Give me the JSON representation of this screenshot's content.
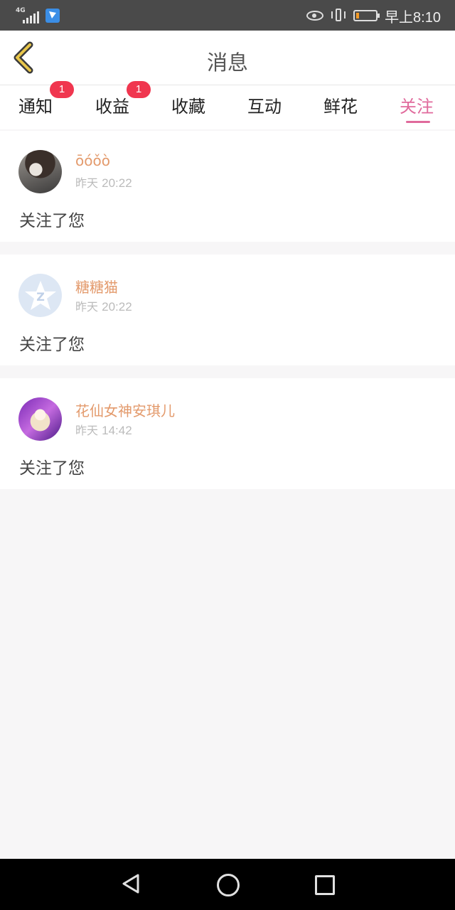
{
  "status_bar": {
    "network": "4G",
    "time": "早上8:10",
    "battery_level": 0.15
  },
  "header": {
    "title": "消息"
  },
  "tabs": [
    {
      "label": "通知",
      "badge": "1"
    },
    {
      "label": "收益",
      "badge": "1"
    },
    {
      "label": "收藏"
    },
    {
      "label": "互动"
    },
    {
      "label": "鲜花"
    },
    {
      "label": "关注",
      "active": true
    }
  ],
  "messages": [
    {
      "name": "ōóǒò",
      "day": "昨天",
      "time": "20:22",
      "text": "关注了您"
    },
    {
      "name": "糖糖猫",
      "day": "昨天",
      "time": "20:22",
      "text": "关注了您"
    },
    {
      "name": "花仙女神安琪儿",
      "day": "昨天",
      "time": "14:42",
      "text": "关注了您"
    }
  ],
  "colors": {
    "accent": "#e06a9c",
    "username": "#e39a6c",
    "badge": "#f0364f"
  }
}
